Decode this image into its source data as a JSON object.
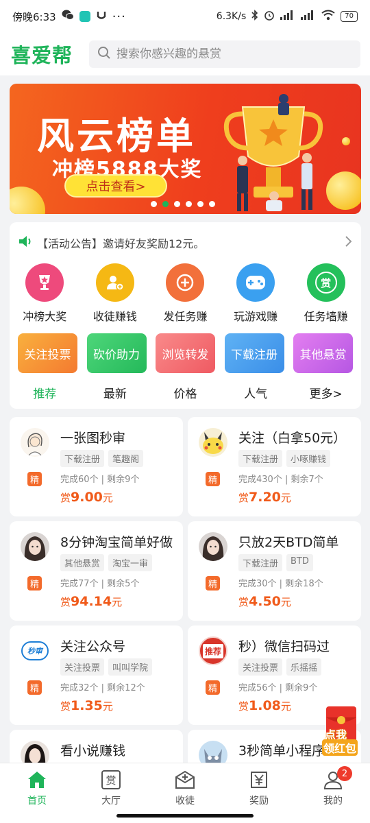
{
  "status_bar": {
    "time": "傍晚6:33",
    "speed": "6.3K/s",
    "battery": "70"
  },
  "header": {
    "logo": "喜爱帮",
    "search_placeholder": "搜索你感兴趣的悬赏"
  },
  "banner": {
    "title": "风云榜单",
    "subtitle": "冲榜5888大奖",
    "cta": "点击查看>",
    "dots": 6,
    "active_dot": 1
  },
  "notice": {
    "text": "【活动公告】邀请好友奖励12元。"
  },
  "categories": [
    {
      "label": "冲榜大奖",
      "icon": "trophy-icon",
      "color": "#ee4a7c"
    },
    {
      "label": "收徒赚钱",
      "icon": "add-user-icon",
      "color": "#f5b814"
    },
    {
      "label": "发任务赚",
      "icon": "plus-icon",
      "color": "#f2703b"
    },
    {
      "label": "玩游戏赚",
      "icon": "gamepad-icon",
      "color": "#3aa0f0"
    },
    {
      "label": "任务墙赚",
      "icon": "reward-icon",
      "color": "#24c05b",
      "glyph": "赏"
    }
  ],
  "tags": [
    {
      "label": "关注投票",
      "from": "#f9b03e",
      "to": "#f47a30"
    },
    {
      "label": "砍价助力",
      "from": "#4ed67a",
      "to": "#24b95a"
    },
    {
      "label": "浏览转发",
      "from": "#f98a8a",
      "to": "#ef5a62"
    },
    {
      "label": "下载注册",
      "from": "#5fb2f4",
      "to": "#3a8ee8"
    },
    {
      "label": "其他悬赏",
      "from": "#e37ef0",
      "to": "#b657e3"
    }
  ],
  "sorts": [
    "推荐",
    "最新",
    "价格",
    "人气",
    "更多>"
  ],
  "tasks": [
    {
      "title": "一张图秒审",
      "tags": [
        "下载注册",
        "笔趣阁"
      ],
      "stats": "完成60个 | 剩余9个",
      "reward": "9.00",
      "avatar": "sketch"
    },
    {
      "title": "关注（白拿50元）",
      "tags": [
        "下载注册",
        "小啄赚钱"
      ],
      "stats": "完成430个 | 剩余7个",
      "reward": "7.20",
      "avatar": "pikachu"
    },
    {
      "title": "8分钟淘宝简单好做",
      "tags": [
        "其他悬赏",
        "淘宝一审"
      ],
      "stats": "完成77个 | 剩余5个",
      "reward": "94.14",
      "avatar": "girl"
    },
    {
      "title": "只放2天BTD简单",
      "tags": [
        "下载注册",
        "BTD"
      ],
      "stats": "完成30个 | 剩余18个",
      "reward": "4.50",
      "avatar": "girl"
    },
    {
      "title": "关注公众号",
      "tags": [
        "关注投票",
        "叫叫学院"
      ],
      "stats": "完成32个 | 剩余12个",
      "reward": "1.35",
      "avatar": "logo",
      "avatar_text": "秒审"
    },
    {
      "title": "秒）微信扫码过",
      "tags": [
        "关注投票",
        "乐摇摇"
      ],
      "stats": "完成56个 | 剩余9个",
      "reward": "1.08",
      "avatar": "badge",
      "avatar_text": "推荐"
    },
    {
      "title": "看小说赚钱",
      "tags": [],
      "stats": "",
      "reward": "",
      "avatar": "girl2"
    },
    {
      "title": "3秒简单小程序",
      "tags": [],
      "stats": "",
      "reward": "",
      "avatar": "cat"
    }
  ],
  "labels": {
    "jing": "精",
    "reward_prefix": "赏",
    "reward_suffix": "元"
  },
  "float_button": {
    "line1": "点我",
    "line2": "领红包"
  },
  "tabbar": [
    {
      "label": "首页",
      "icon": "home-icon",
      "active": true
    },
    {
      "label": "大厅",
      "icon": "hall-icon",
      "glyph": "赏"
    },
    {
      "label": "收徒",
      "icon": "mail-add-icon"
    },
    {
      "label": "奖励",
      "icon": "yuan-icon"
    },
    {
      "label": "我的",
      "icon": "user-icon",
      "badge": "2"
    }
  ]
}
